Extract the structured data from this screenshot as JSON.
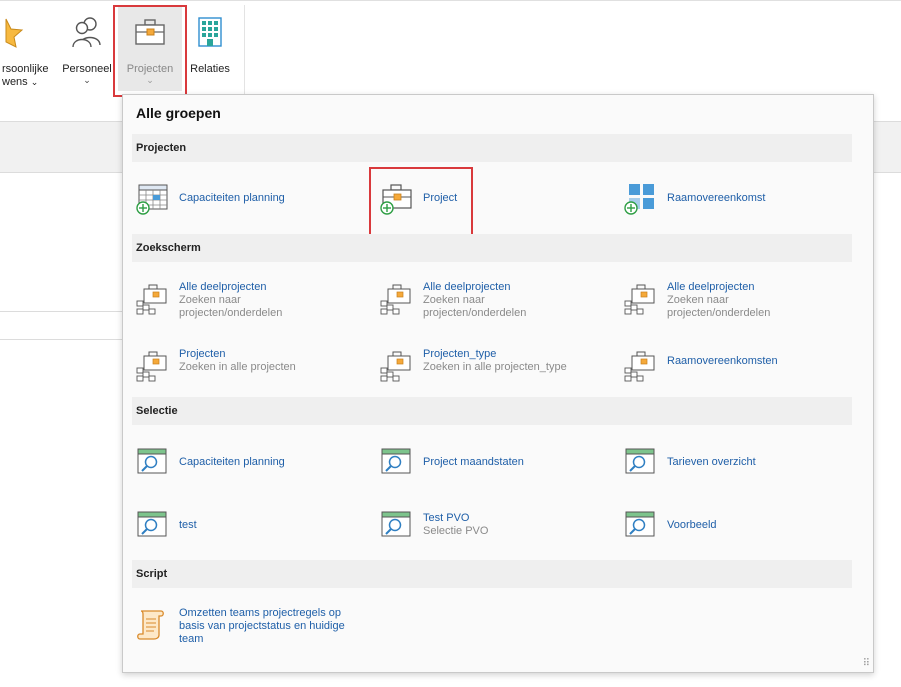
{
  "ribbon": {
    "buttons": [
      {
        "id": "persoonlijke",
        "label_line1": "rsoonlijke",
        "label_line2": "wens"
      },
      {
        "id": "personeel",
        "label": "Personeel"
      },
      {
        "id": "projecten",
        "label": "Projecten"
      },
      {
        "id": "relaties",
        "label": "Relaties"
      }
    ],
    "chevron": "⌄"
  },
  "popup": {
    "title": "Alle groepen",
    "sections": [
      {
        "title": "Projecten"
      },
      {
        "title": "Zoekscherm"
      },
      {
        "title": "Selectie"
      },
      {
        "title": "Script"
      }
    ],
    "projecten_items": [
      {
        "title": "Capaciteiten planning"
      },
      {
        "title": "Project"
      },
      {
        "title": "Raamovereenkomst"
      }
    ],
    "zoekscherm_items": [
      {
        "title": "Alle deelprojecten",
        "subtitle": "Zoeken naar projecten/onderdelen"
      },
      {
        "title": "Alle deelprojecten",
        "subtitle": "Zoeken naar projecten/onderdelen"
      },
      {
        "title": "Alle deelprojecten",
        "subtitle": "Zoeken naar projecten/onderdelen"
      },
      {
        "title": "Projecten",
        "subtitle": "Zoeken in alle projecten"
      },
      {
        "title": "Projecten_type",
        "subtitle": "Zoeken in alle projecten_type"
      },
      {
        "title": "Raamovereenkomsten"
      }
    ],
    "selectie_items": [
      {
        "title": "Capaciteiten planning"
      },
      {
        "title": "Project maandstaten"
      },
      {
        "title": "Tarieven overzicht"
      },
      {
        "title": "test"
      },
      {
        "title": "Test PVO",
        "subtitle": "Selectie PVO"
      },
      {
        "title": "Voorbeeld"
      }
    ],
    "script_items": [
      {
        "title": "Omzetten teams projectregels op basis van projectstatus en huidige team"
      }
    ],
    "grip": "⠿"
  },
  "colors": {
    "link": "#1f5fa8",
    "subtitle": "#8a8a8a",
    "highlight": "#d9393c",
    "folder_orange": "#f5a93a",
    "plus_green": "#2e9e44",
    "search_green": "#7dc48c",
    "grid_blue": "#4a9bd8"
  }
}
